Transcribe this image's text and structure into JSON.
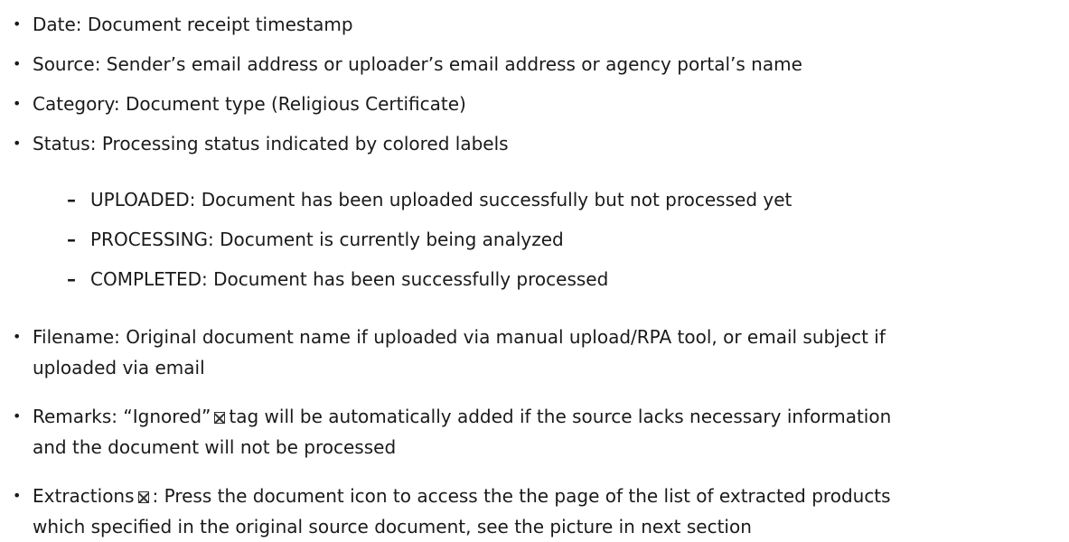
{
  "items": [
    "Date: Document receipt timestamp",
    "Source: Sender’s email address or uploader’s email address or agency portal’s name",
    "Category: Document type (Religious Certificate)",
    "Status: Processing status indicated by colored labels"
  ],
  "status_subitems": [
    "UPLOADED: Document has been uploaded successfully but not processed yet",
    "PROCESSING: Document is currently being analyzed",
    "COMPLETED: Document has been successfully processed"
  ],
  "filename": {
    "line1": "Filename: Original document name if uploaded via manual upload/RPA tool, or email subject if",
    "line2": "uploaded via email"
  },
  "remarks": {
    "before_icon": "Remarks: “Ignored”",
    "after_icon": "tag will be automatically added if the source lacks necessary information",
    "line2": "and the document will not be processed"
  },
  "extractions": {
    "before_icon": "Extractions",
    "after_icon": ": Press the document icon to access the the page of the list of extracted products",
    "line2": "which specified in the original source document, see the picture in next section"
  },
  "icons": {
    "ignored_tag": "tag-icon",
    "document": "document-icon"
  }
}
